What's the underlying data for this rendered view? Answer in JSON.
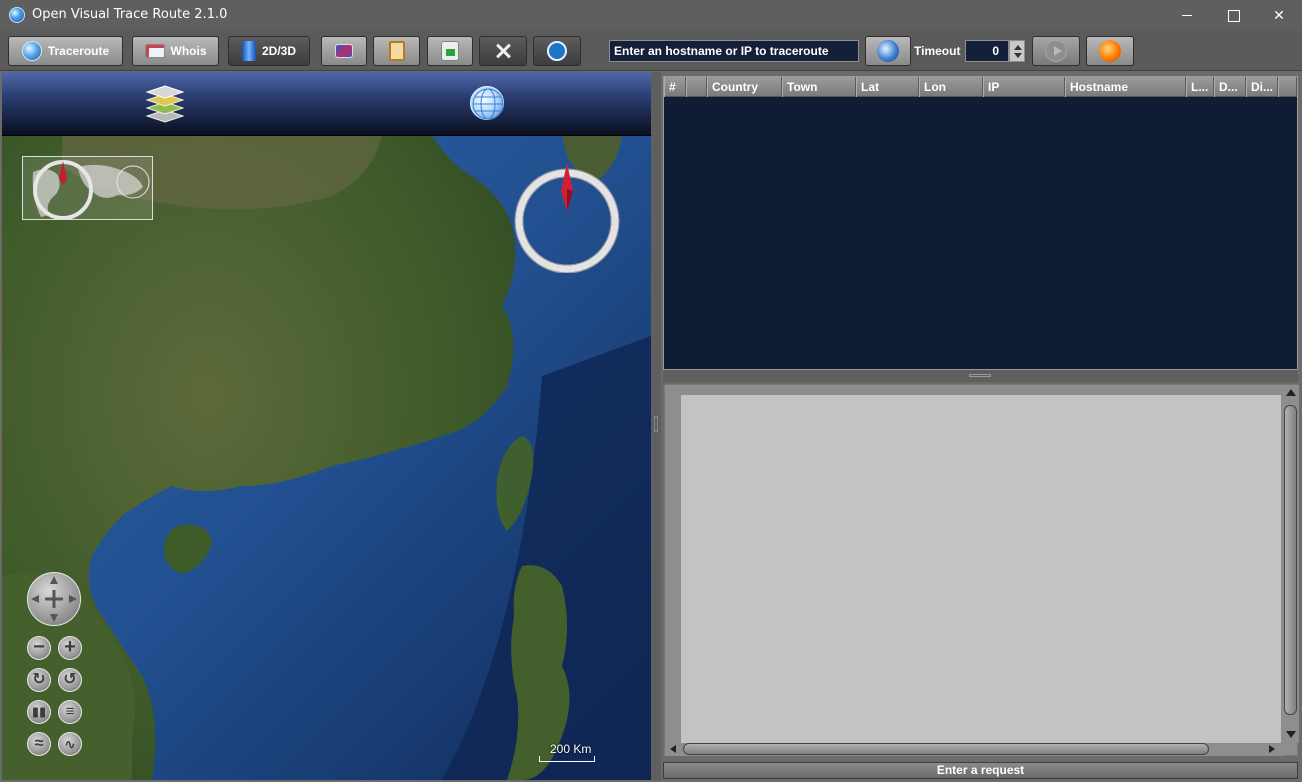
{
  "window": {
    "title": "Open Visual Trace Route 2.1.0"
  },
  "toolbar": {
    "traceroute_label": "Traceroute",
    "whois_label": "Whois",
    "view_label": "2D/3D",
    "host_input_placeholder": "Enter an hostname or IP to traceroute",
    "timeout_label": "Timeout",
    "timeout_value": "0"
  },
  "map": {
    "scale_label": "200 Km"
  },
  "table": {
    "columns": [
      "#",
      "",
      "Country",
      "Town",
      "Lat",
      "Lon",
      "IP",
      "Hostname",
      "L...",
      "D...",
      "Di..."
    ]
  },
  "status": {
    "text": "Enter a request"
  },
  "colors": {
    "accent": "#14203a",
    "table_bg": "#101c33"
  }
}
